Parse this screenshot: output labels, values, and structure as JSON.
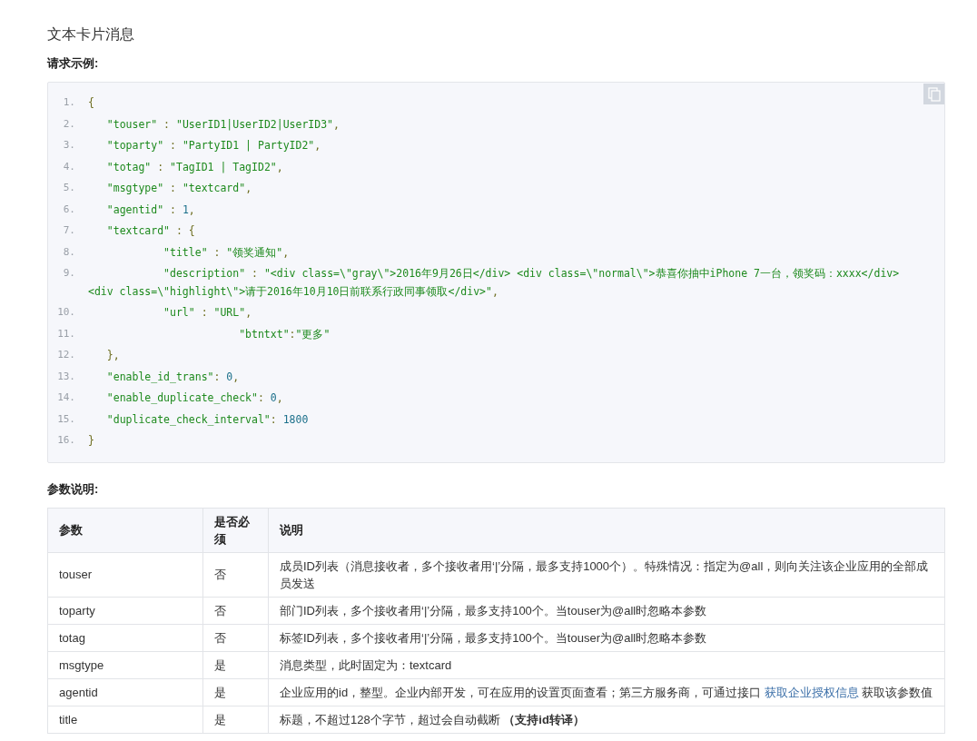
{
  "section_title": "文本卡片消息",
  "request_heading": "请求示例:",
  "code": {
    "lines": [
      {
        "number": "1.",
        "tokens": [
          {
            "kind": "punct",
            "text": "{"
          }
        ]
      },
      {
        "number": "2.",
        "tokens": [
          {
            "kind": "string",
            "text": "   \"touser\""
          },
          {
            "kind": "punct",
            "text": " : "
          },
          {
            "kind": "string",
            "text": "\"UserID1|UserID2|UserID3\""
          },
          {
            "kind": "punct",
            "text": ","
          }
        ]
      },
      {
        "number": "3.",
        "tokens": [
          {
            "kind": "string",
            "text": "   \"toparty\""
          },
          {
            "kind": "punct",
            "text": " : "
          },
          {
            "kind": "string",
            "text": "\"PartyID1 | PartyID2\""
          },
          {
            "kind": "punct",
            "text": ","
          }
        ]
      },
      {
        "number": "4.",
        "tokens": [
          {
            "kind": "string",
            "text": "   \"totag\""
          },
          {
            "kind": "punct",
            "text": " : "
          },
          {
            "kind": "string",
            "text": "\"TagID1 | TagID2\""
          },
          {
            "kind": "punct",
            "text": ","
          }
        ]
      },
      {
        "number": "5.",
        "tokens": [
          {
            "kind": "string",
            "text": "   \"msgtype\""
          },
          {
            "kind": "punct",
            "text": " : "
          },
          {
            "kind": "string",
            "text": "\"textcard\""
          },
          {
            "kind": "punct",
            "text": ","
          }
        ]
      },
      {
        "number": "6.",
        "tokens": [
          {
            "kind": "string",
            "text": "   \"agentid\""
          },
          {
            "kind": "punct",
            "text": " : "
          },
          {
            "kind": "number",
            "text": "1"
          },
          {
            "kind": "punct",
            "text": ","
          }
        ]
      },
      {
        "number": "7.",
        "tokens": [
          {
            "kind": "string",
            "text": "   \"textcard\""
          },
          {
            "kind": "punct",
            "text": " : {"
          }
        ]
      },
      {
        "number": "8.",
        "tokens": [
          {
            "kind": "string",
            "text": "            \"title\""
          },
          {
            "kind": "punct",
            "text": " : "
          },
          {
            "kind": "string",
            "text": "\"领奖通知\""
          },
          {
            "kind": "punct",
            "text": ","
          }
        ]
      },
      {
        "number": "9.",
        "tokens": [
          {
            "kind": "string",
            "text": "            \"description\""
          },
          {
            "kind": "punct",
            "text": " : "
          },
          {
            "kind": "string",
            "text": "\"<div class=\\\"gray\\\">2016年9月26日</div> <div class=\\\"normal\\\">恭喜你抽中iPhone 7一台，领奖码：xxxx</div> <div class=\\\"highlight\\\">请于2016年10月10日前联系行政同事领取</div>\""
          },
          {
            "kind": "punct",
            "text": ","
          }
        ]
      },
      {
        "number": "10.",
        "tokens": [
          {
            "kind": "string",
            "text": "            \"url\""
          },
          {
            "kind": "punct",
            "text": " : "
          },
          {
            "kind": "string",
            "text": "\"URL\""
          },
          {
            "kind": "punct",
            "text": ","
          }
        ]
      },
      {
        "number": "11.",
        "tokens": [
          {
            "kind": "string",
            "text": "                        \"btntxt\""
          },
          {
            "kind": "punct",
            "text": ":"
          },
          {
            "kind": "string",
            "text": "\"更多\""
          }
        ]
      },
      {
        "number": "12.",
        "tokens": [
          {
            "kind": "punct",
            "text": "   },"
          }
        ]
      },
      {
        "number": "13.",
        "tokens": [
          {
            "kind": "string",
            "text": "   \"enable_id_trans\""
          },
          {
            "kind": "punct",
            "text": ": "
          },
          {
            "kind": "number",
            "text": "0"
          },
          {
            "kind": "punct",
            "text": ","
          }
        ]
      },
      {
        "number": "14.",
        "tokens": [
          {
            "kind": "string",
            "text": "   \"enable_duplicate_check\""
          },
          {
            "kind": "punct",
            "text": ": "
          },
          {
            "kind": "number",
            "text": "0"
          },
          {
            "kind": "punct",
            "text": ","
          }
        ]
      },
      {
        "number": "15.",
        "tokens": [
          {
            "kind": "string",
            "text": "   \"duplicate_check_interval\""
          },
          {
            "kind": "punct",
            "text": ": "
          },
          {
            "kind": "number",
            "text": "1800"
          }
        ]
      },
      {
        "number": "16.",
        "tokens": [
          {
            "kind": "punct",
            "text": "}"
          }
        ]
      }
    ]
  },
  "params_heading": "参数说明:",
  "table": {
    "columns": [
      "参数",
      "是否必须",
      "说明"
    ],
    "rows": [
      {
        "name": "touser",
        "required": "否",
        "description": [
          {
            "kind": "text",
            "text": "成员ID列表（消息接收者，多个接收者用‘|’分隔，最多支持1000个）。特殊情况：指定为@all，则向关注该企业应用的全部成员发送"
          }
        ]
      },
      {
        "name": "toparty",
        "required": "否",
        "description": [
          {
            "kind": "text",
            "text": "部门ID列表，多个接收者用‘|’分隔，最多支持100个。当touser为@all时忽略本参数"
          }
        ]
      },
      {
        "name": "totag",
        "required": "否",
        "description": [
          {
            "kind": "text",
            "text": "标签ID列表，多个接收者用‘|’分隔，最多支持100个。当touser为@all时忽略本参数"
          }
        ]
      },
      {
        "name": "msgtype",
        "required": "是",
        "description": [
          {
            "kind": "text",
            "text": "消息类型，此时固定为：textcard"
          }
        ]
      },
      {
        "name": "agentid",
        "required": "是",
        "description": [
          {
            "kind": "text",
            "text": "企业应用的id，整型。企业内部开发，可在应用的设置页面查看；第三方服务商，可通过接口 "
          },
          {
            "kind": "link",
            "text": "获取企业授权信息"
          },
          {
            "kind": "text",
            "text": " 获取该参数值"
          }
        ]
      },
      {
        "name": "title",
        "required": "是",
        "description": [
          {
            "kind": "text",
            "text": "标题，不超过128个字节，超过会自动截断 **（支持id转译）**"
          }
        ]
      }
    ]
  }
}
